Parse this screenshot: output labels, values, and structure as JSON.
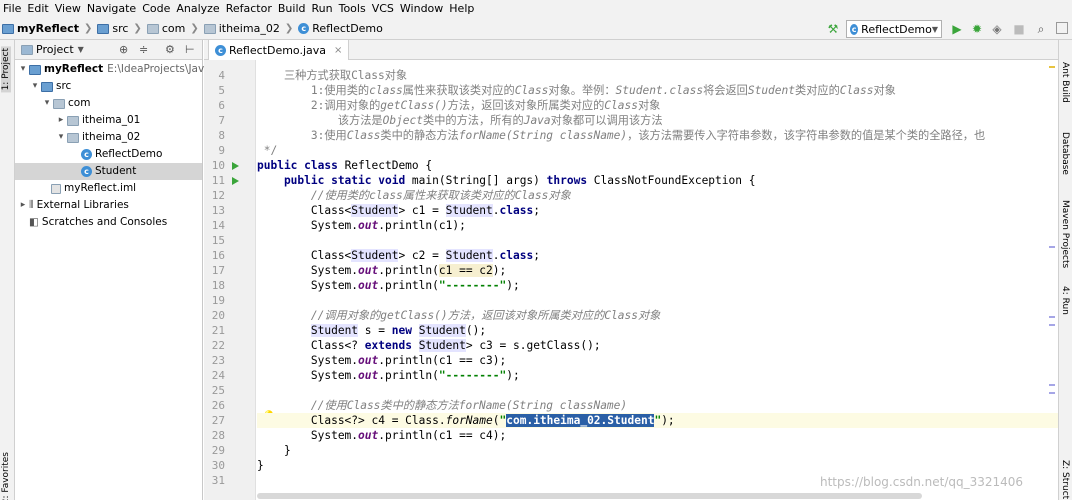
{
  "menu": [
    "File",
    "Edit",
    "View",
    "Navigate",
    "Code",
    "Analyze",
    "Refactor",
    "Build",
    "Run",
    "Tools",
    "VCS",
    "Window",
    "Help"
  ],
  "breadcrumb": [
    "myReflect",
    "src",
    "com",
    "itheima_02",
    "ReflectDemo"
  ],
  "run_config": "ReflectDemo",
  "left_tabs": {
    "project": "1: Project",
    "favorites": "2: Favorites"
  },
  "right_tabs": {
    "ant": "Ant Build",
    "database": "Database",
    "maven": "Maven Projects",
    "run": "4: Run",
    "structure": "Z: Struct"
  },
  "project_panel": {
    "title": "Project",
    "tree": [
      {
        "label": "myReflect",
        "path": "E:\\IdeaProjects\\JavaSE"
      },
      {
        "label": "src"
      },
      {
        "label": "com"
      },
      {
        "label": "itheima_01"
      },
      {
        "label": "itheima_02"
      },
      {
        "label": "ReflectDemo"
      },
      {
        "label": "Student"
      },
      {
        "label": "myReflect.iml"
      },
      {
        "label": "External Libraries"
      },
      {
        "label": "Scratches and Consoles"
      }
    ]
  },
  "editor_tab": "ReflectDemo.java",
  "line_numbers": [
    "4",
    "5",
    "6",
    "7",
    "8",
    "9",
    "10",
    "11",
    "12",
    "13",
    "14",
    "15",
    "16",
    "17",
    "18",
    "19",
    "20",
    "21",
    "22",
    "23",
    "24",
    "25",
    "26",
    "27",
    "28",
    "29",
    "30",
    "31"
  ],
  "code": {
    "l4": "    三种方式获取Class对象",
    "l5a": "        1:使用类的",
    "l5b": "class",
    "l5c": "属性来获取该类对应的",
    "l5d": "Class",
    "l5e": "对象。举例：",
    "l5f": "Student.class",
    "l5g": "将会返回",
    "l5h": "Student",
    "l5i": "类对应的",
    "l5j": "Class",
    "l5k": "对象",
    "l6a": "        2:调用对象的",
    "l6b": "getClass()",
    "l6c": "方法，返回该对象所属类对应的",
    "l6d": "Class",
    "l6e": "对象",
    "l7a": "            该方法是",
    "l7b": "Object",
    "l7c": "类中的方法，所有的",
    "l7d": "Java",
    "l7e": "对象都可以调用该方法",
    "l8a": "        3:使用",
    "l8b": "Class",
    "l8c": "类中的静态方法",
    "l8d": "forName(String className)",
    "l8e": "，该方法需要传入字符串参数，该字符串参数的值是某个类的全路径，也",
    "l9": " */",
    "l10a": "public class",
    "l10b": " ReflectDemo {",
    "l11a": "    public static void",
    "l11b": " main(String[] args) ",
    "l11c": "throws",
    "l11d": " ClassNotFoundException {",
    "l12a": "        //使用类的",
    "l12b": "class",
    "l12c": "属性来获取该类对应的",
    "l12d": "Class",
    "l12e": "对象",
    "l13a": "        Class<",
    "l13b": "Student",
    "l13c": "> c1 = ",
    "l13d": "Student",
    "l13e": ".",
    "l13f": "class",
    "l13g": ";",
    "l14a": "        System.",
    "l14b": "out",
    "l14c": ".println(c1);",
    "l16a": "        Class<",
    "l16b": "Student",
    "l16c": "> c2 = ",
    "l16d": "Student",
    "l16e": ".",
    "l16f": "class",
    "l16g": ";",
    "l17a": "        System.",
    "l17b": "out",
    "l17c": ".println(",
    "l17d": "c1 == c2",
    "l17e": ");",
    "l18a": "        System.",
    "l18b": "out",
    "l18c": ".println(",
    "l18d": "\"--------\"",
    "l18e": ");",
    "l20a": "        //调用对象的",
    "l20b": "getClass()",
    "l20c": "方法，返回该对象所属类对应的",
    "l20d": "Class",
    "l20e": "对象",
    "l21a": "        ",
    "l21b": "Student",
    "l21c": " s = ",
    "l21d": "new",
    "l21e": " ",
    "l21f": "Student",
    "l21g": "();",
    "l22a": "        Class<? ",
    "l22b": "extends",
    "l22c": " ",
    "l22d": "Student",
    "l22e": "> c3 = s.getClass();",
    "l23a": "        System.",
    "l23b": "out",
    "l23c": ".println(c1 == c3);",
    "l24a": "        System.",
    "l24b": "out",
    "l24c": ".println(",
    "l24d": "\"--------\"",
    "l24e": ");",
    "l26a": "        //使用",
    "l26b": "Class",
    "l26c": "类中的静态方法",
    "l26d": "forName(String className)",
    "l27a": "        Class<?> c4 = Class.",
    "l27b": "forName",
    "l27c": "(",
    "l27d": "\"",
    "l27e": "com.itheima_02.Student",
    "l27f": "\"",
    "l27g": ");",
    "l28a": "        System.",
    "l28b": "out",
    "l28c": ".println(c1 == c4);",
    "l29": "    }",
    "l30": "}"
  },
  "watermark": "https://blog.csdn.net/qq_3321406"
}
